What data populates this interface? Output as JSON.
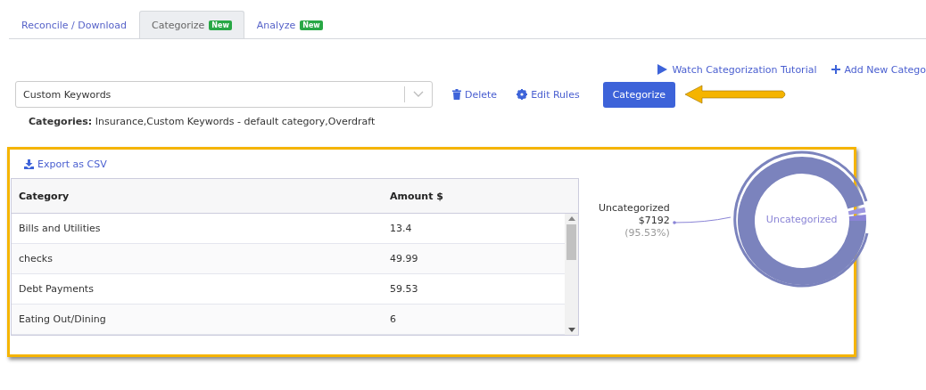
{
  "tabs": [
    {
      "label": "Reconcile / Download",
      "selected": false
    },
    {
      "label": "Categorize",
      "badge": "New",
      "selected": true
    },
    {
      "label": "Analyze",
      "badge": "New",
      "selected": false
    }
  ],
  "top_links": [
    "Watch Categorization Tutorial",
    "Add New Catego"
  ],
  "rule_select": {
    "value": "Custom Keywords"
  },
  "actions": {
    "delete": "Delete",
    "edit_rules": "Edit Rules",
    "categorize": "Categorize"
  },
  "categories": {
    "label": "Categories:",
    "value": "Insurance,Custom Keywords - default category,Overdraft"
  },
  "export_link": "Export as CSV",
  "table": {
    "columns": [
      "Category",
      "Amount $"
    ],
    "rows": [
      [
        "Bills and Utilities",
        "13.4"
      ],
      [
        "checks",
        "49.99"
      ],
      [
        "Debt Payments",
        "59.53"
      ],
      [
        "Eating Out/Dining",
        "6"
      ]
    ]
  },
  "donut": {
    "center_label": "Uncategorized",
    "callout": {
      "name": "Uncategorized",
      "amount": "$7192",
      "percent": "(95.53%)"
    }
  }
}
